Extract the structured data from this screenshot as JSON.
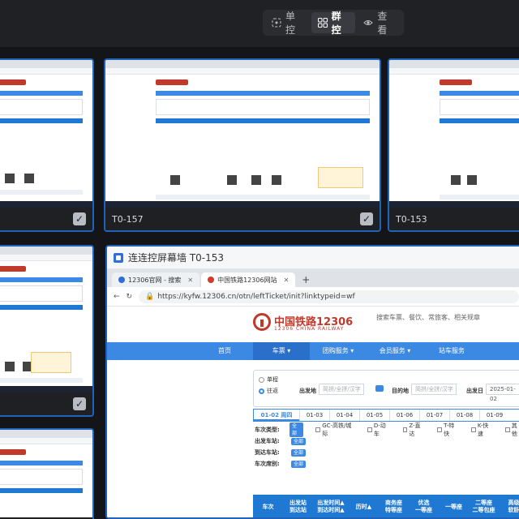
{
  "toolbar": {
    "modes": [
      {
        "label": "单控",
        "icon": "single-control-icon",
        "active": false
      },
      {
        "label": "群控",
        "icon": "group-control-icon",
        "active": true
      },
      {
        "label": "查看",
        "icon": "eye-icon",
        "active": false
      }
    ]
  },
  "tiles": [
    {
      "label": ""
    },
    {
      "label": "T0-157"
    },
    {
      "label": "T0-153"
    },
    {
      "label": ""
    },
    {
      "label": ""
    }
  ],
  "big_window": {
    "title": "连连控屏幕墙 T0-153",
    "tabs": [
      {
        "label": "12306官网 - 搜索",
        "icon": "search-favicon-icon"
      },
      {
        "label": "中国铁路12306网站",
        "icon": "railway-favicon-icon",
        "active": true
      }
    ],
    "url": "https://kyfw.12306.cn/otn/leftTicket/init?linktypeid=wf",
    "logo_cn": "中国铁路12306",
    "logo_en": "12306 CHINA RAILWAY",
    "site_search": "搜索车票、餐饮、常旅客、相关规章",
    "nav": [
      "首页",
      "车票 ▾",
      "团购服务 ▾",
      "会员服务 ▾",
      "站车服务"
    ],
    "trip_types": [
      "单程",
      "往返"
    ],
    "from_label": "出发地",
    "from_placeholder": "简拼/全拼/汉字",
    "to_label": "目的地",
    "to_placeholder": "简拼/全拼/汉字",
    "date_label": "出发日",
    "date_value": "2025-01-02",
    "dates": [
      "01-02 周四",
      "01-03",
      "01-04",
      "01-05",
      "01-06",
      "01-07",
      "01-08",
      "01-09"
    ],
    "filters": {
      "type_label": "车次类型:",
      "all": "全部",
      "types": [
        "GC-高铁/城际",
        "D-动车",
        "Z-直达",
        "T-特快",
        "K-快速",
        "其他"
      ],
      "from_station": "出发车站:",
      "to_station": "到达车站:",
      "seat_type": "车次席别:"
    },
    "table_headers": [
      "车次",
      "出发站\n到达站",
      "出发时间▲\n到达时间▲",
      "历时▲",
      "商务座\n特等座",
      "优选\n一等座",
      "一等座",
      "二等座\n二等包座",
      "高级\n软卧"
    ]
  }
}
